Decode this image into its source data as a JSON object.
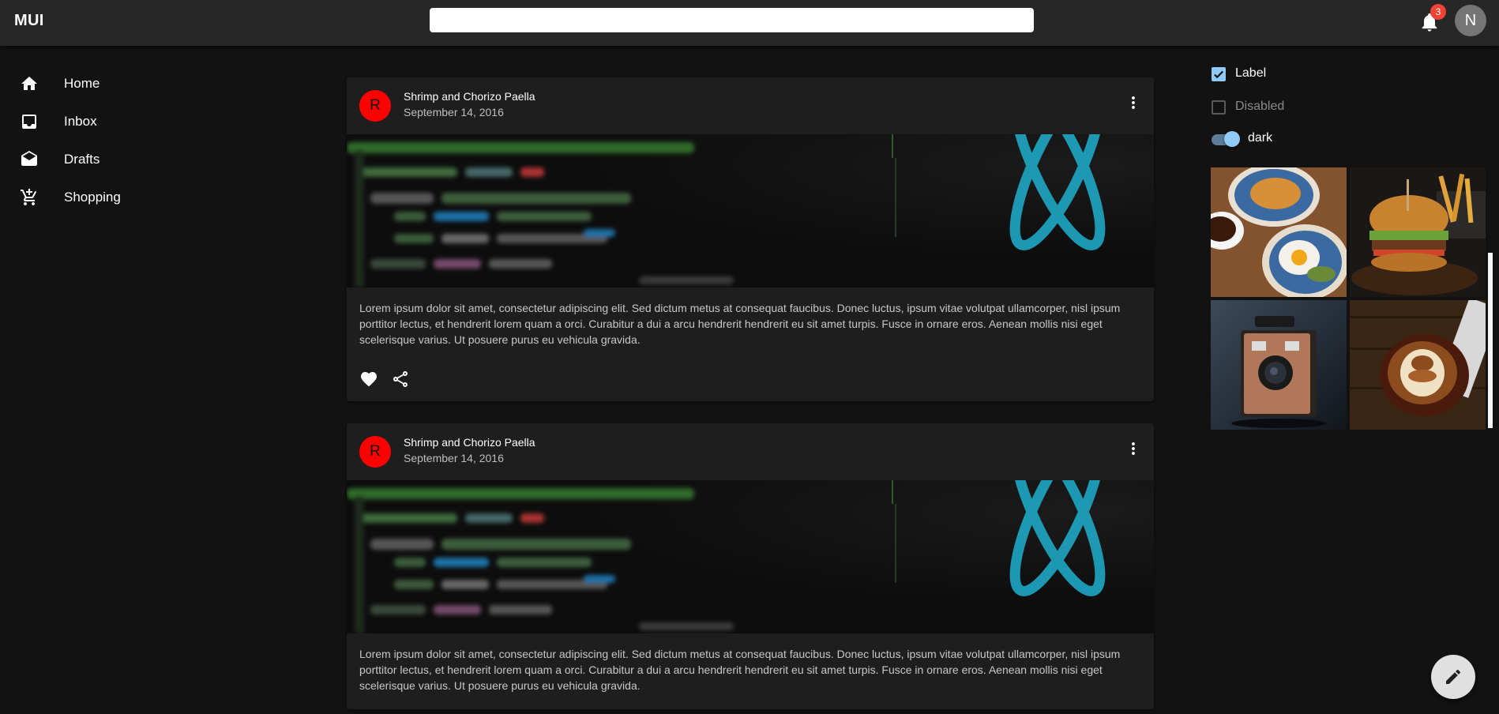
{
  "app": {
    "logo": "MUI"
  },
  "header": {
    "search": {
      "value": "",
      "placeholder": ""
    },
    "notifications": {
      "count": "3",
      "icon": "bell-icon"
    },
    "avatar_initial": "N"
  },
  "sidebar": {
    "items": [
      {
        "label": "Home",
        "icon": "home-icon"
      },
      {
        "label": "Inbox",
        "icon": "inbox-icon"
      },
      {
        "label": "Drafts",
        "icon": "drafts-icon"
      },
      {
        "label": "Shopping",
        "icon": "shopping-cart-icon"
      }
    ]
  },
  "posts": [
    {
      "avatar": "R",
      "title": "Shrimp and Chorizo Paella",
      "date": "September 14, 2016",
      "body": "Lorem ipsum dolor sit amet, consectetur adipiscing elit. Sed dictum metus at consequat faucibus. Donec luctus, ipsum vitae volutpat ullamcorper, nisl ipsum porttitor lectus, et hendrerit lorem quam a orci. Curabitur a dui a arcu hendrerit hendrerit eu sit amet turpis. Fusce in ornare eros. Aenean mollis nisi eget scelerisque varius. Ut posuere purus eu vehicula gravida."
    },
    {
      "avatar": "R",
      "title": "Shrimp and Chorizo Paella",
      "date": "September 14, 2016",
      "body": "Lorem ipsum dolor sit amet, consectetur adipiscing elit. Sed dictum metus at consequat faucibus. Donec luctus, ipsum vitae volutpat ullamcorper, nisl ipsum porttitor lectus, et hendrerit lorem quam a orci. Curabitur a dui a arcu hendrerit hendrerit eu sit amet turpis. Fusce in ornare eros. Aenean mollis nisi eget scelerisque varius. Ut posuere purus eu vehicula gravida."
    }
  ],
  "controls": {
    "checkbox_label": "Label",
    "checkbox_checked": true,
    "disabled_label": "Disabled",
    "switch_label": "dark",
    "switch_on": true
  },
  "image_tiles": [
    "breakfast-photo",
    "burger-photo",
    "camera-photo",
    "coffee-photo"
  ],
  "colors": {
    "appbar": "#272727",
    "background": "#121212",
    "card": "#1e1e1e",
    "accent": "#90caf9",
    "avatar": "#ff0000",
    "badge": "#f44336"
  }
}
